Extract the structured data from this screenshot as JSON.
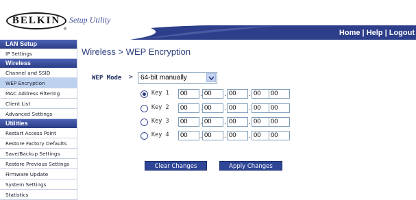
{
  "header": {
    "logo_text": "BELKIN",
    "logo_mark": "®",
    "title": "Setup Utility",
    "links": [
      "Home",
      "Help",
      "Logout"
    ],
    "link_separator": " | ",
    "band_color": "#2d3e8a"
  },
  "sidebar": {
    "sections": [
      {
        "title": "LAN Setup",
        "items": [
          "IP Settings"
        ]
      },
      {
        "title": "Wireless",
        "items": [
          "Channel and SSID",
          "WEP Encryption",
          "MAC Address Filtering",
          "Client List",
          "Advanced Settings"
        ]
      },
      {
        "title": "Utilities",
        "items": [
          "Restart Access Point",
          "Restore Factory Defaults",
          "Save/Backup Settings",
          "Restore Previous Settings",
          "Firmware Update",
          "System Settings",
          "Statistics"
        ]
      }
    ],
    "active_item": "WEP Encryption"
  },
  "main": {
    "page_title": "Wireless > WEP Encryption",
    "wep_mode_label": "WEP Mode",
    "wep_mode_arrow": ">",
    "wep_mode_value": "64-bit manually",
    "selected_key": 1,
    "separator": ".",
    "keys": [
      {
        "label": "Key 1",
        "values": [
          "00",
          "00",
          "00",
          "00",
          "00"
        ]
      },
      {
        "label": "Key 2",
        "values": [
          "00",
          "00",
          "00",
          "00",
          "00"
        ]
      },
      {
        "label": "Key 3",
        "values": [
          "00",
          "00",
          "00",
          "00",
          "00"
        ]
      },
      {
        "label": "Key 4",
        "values": [
          "00",
          "00",
          "00",
          "00",
          "00"
        ]
      }
    ],
    "clear_button": "Clear Changes",
    "apply_button": "Apply Changes"
  },
  "icons": {
    "select_arrow": "chevron-down-icon",
    "radio": "radio-button-icon"
  }
}
